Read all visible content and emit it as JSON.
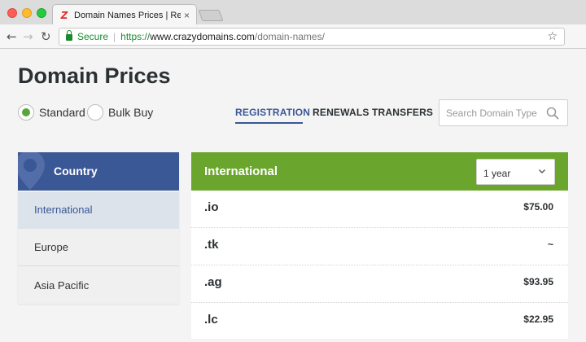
{
  "browser": {
    "tab_title": "Domain Names Prices | Registr",
    "tab_close": "×",
    "secure_label": "Secure",
    "url_scheme": "https://",
    "url_host": "www.crazydomains.com",
    "url_path": "/domain-names/",
    "favicon": "Z"
  },
  "page": {
    "title": "Domain Prices"
  },
  "mode": {
    "options": [
      {
        "label": "Standard",
        "selected": true
      },
      {
        "label": "Bulk Buy",
        "selected": false
      }
    ]
  },
  "filters": {
    "tabs": [
      {
        "label": "REGISTRATION",
        "active": true
      },
      {
        "label": "RENEWALS",
        "active": false
      },
      {
        "label": "TRANSFERS",
        "active": false
      }
    ]
  },
  "search": {
    "placeholder": "Search Domain Type"
  },
  "sidebar": {
    "title": "Country",
    "items": [
      {
        "label": "International",
        "active": true
      },
      {
        "label": "Europe",
        "active": false
      },
      {
        "label": "Asia Pacific",
        "active": false
      }
    ]
  },
  "main": {
    "title": "International",
    "term_selected": "1 year",
    "rows": [
      {
        "tld": ".io",
        "price": "$75.00"
      },
      {
        "tld": ".tk",
        "price": "~"
      },
      {
        "tld": ".ag",
        "price": "$93.95"
      },
      {
        "tld": ".lc",
        "price": "$22.95"
      }
    ]
  },
  "icons": {
    "back": "arrow-left-icon",
    "forward": "arrow-right-icon",
    "reload": "reload-icon",
    "bookmark": "star-icon",
    "lock": "lock-icon",
    "search": "search-icon",
    "location": "map-pin-icon",
    "select_caret": "chevron-down-icon"
  },
  "colors": {
    "brand_blue": "#3a5796",
    "brand_green": "#6aa62d",
    "radio_green": "#5aa53a",
    "secure_green": "#1b8a2f"
  }
}
